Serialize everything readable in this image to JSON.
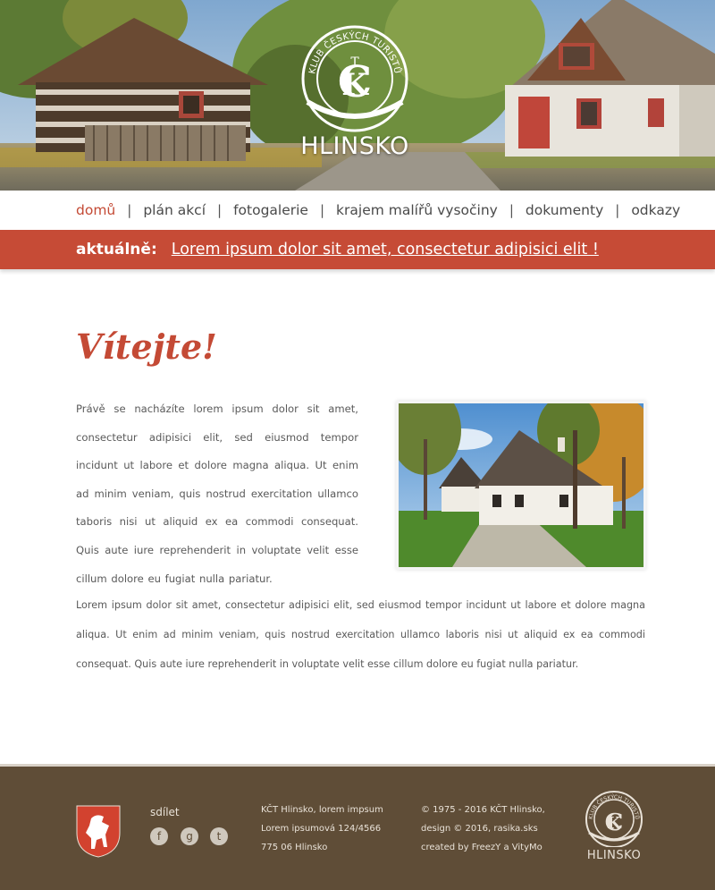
{
  "header": {
    "logo_arc_text": "KLUB ČESKÝCH TURISTŮ",
    "logo_title": "HLINSKO"
  },
  "nav": {
    "items": [
      {
        "label": "domů",
        "active": true
      },
      {
        "label": "plán akcí"
      },
      {
        "label": "fotogalerie"
      },
      {
        "label": "krajem malířů vysočiny"
      },
      {
        "label": "dokumenty"
      },
      {
        "label": "odkazy"
      }
    ],
    "separator": "|"
  },
  "news": {
    "label": "aktuálně:",
    "link": "Lorem ipsum dolor sit amet, consectetur adipisici elit !"
  },
  "main": {
    "heading": "Vítejte!",
    "intro": "Právě se nacházíte lorem ipsum dolor sit amet, consectetur adipisici elit, sed eiusmod tempor incidunt ut labore et dolore magna aliqua. Ut enim ad minim veniam, quis nostrud exercitation ullamco taboris nisi ut aliquid ex ea commodi consequat. Quis aute iure reprehenderit in voluptate velit esse cillum dolore eu fugiat nulla pariatur.",
    "body": "Lorem ipsum dolor sit amet, consectetur adipisici elit, sed eiusmod tempor incidunt ut labore et dolore magna aliqua. Ut enim ad minim veniam, quis nostrud exercitation ullamco laboris nisi ut aliquid ex ea commodi consequat. Quis aute iure reprehenderit in voluptate velit esse cillum dolore eu fugiat nulla pariatur."
  },
  "footer": {
    "share_label": "sdílet",
    "social": [
      "f",
      "g",
      "t"
    ],
    "contact": [
      "KČT Hlinsko, lorem impsum",
      "Lorem ipsumová 124/4566",
      "775 06 Hlinsko"
    ],
    "credits": [
      "© 1975 - 2016 KČT Hlinsko,",
      "design © 2016, rasika.sks",
      "created by FreezY a VityMo"
    ],
    "logo_arc_text": "KLUB ČESKÝCH TURISTŮ",
    "logo_title": "HLINSKO"
  },
  "colors": {
    "accent": "#c64b36",
    "footer_bg": "#5f4d37",
    "footer_text": "#e9e2d8"
  }
}
